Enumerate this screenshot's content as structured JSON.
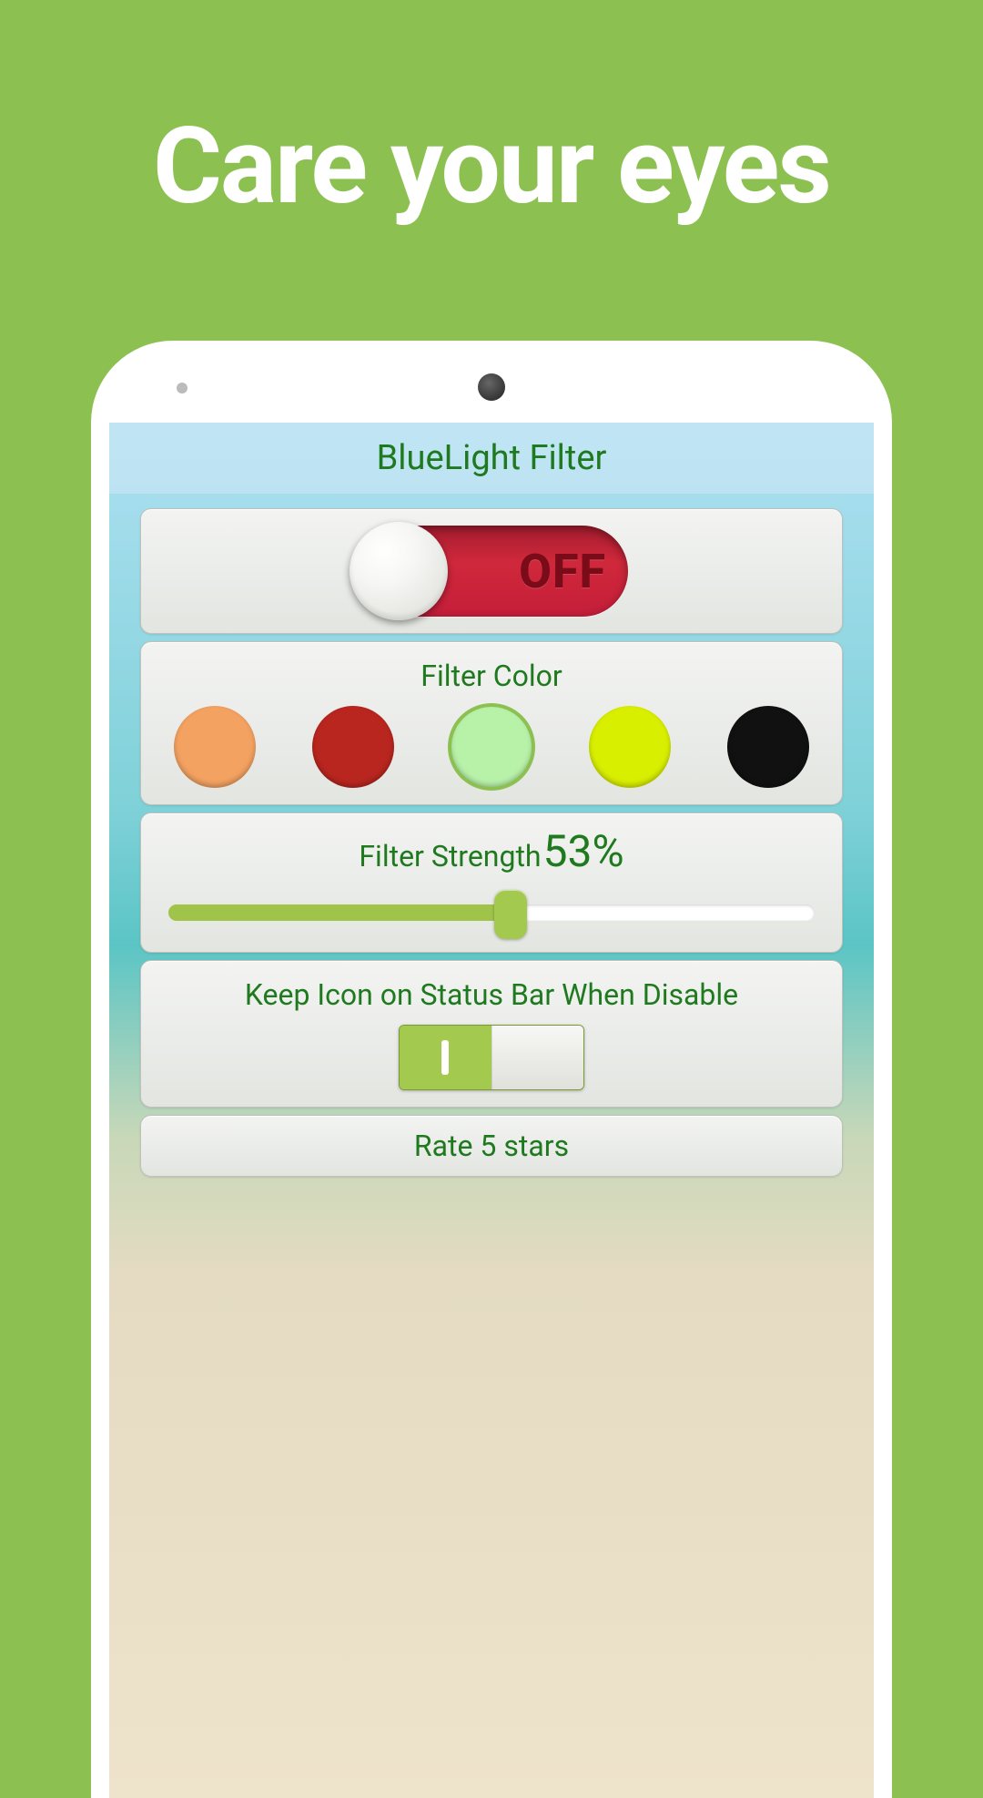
{
  "tagline": "Care your eyes",
  "app": {
    "title": "BlueLight Filter"
  },
  "toggle": {
    "state_label": "OFF"
  },
  "filter_color": {
    "label": "Filter Color",
    "options": [
      {
        "name": "orange",
        "hex": "#f4a261",
        "selected": false
      },
      {
        "name": "red",
        "hex": "#b9261f",
        "selected": false
      },
      {
        "name": "green",
        "hex": "#b8f2a9",
        "selected": true
      },
      {
        "name": "yellow",
        "hex": "#d9ef00",
        "selected": false
      },
      {
        "name": "black",
        "hex": "#111111",
        "selected": false
      }
    ]
  },
  "strength": {
    "label": "Filter Strength",
    "value_text": "53%",
    "value": 53,
    "min": 0,
    "max": 100
  },
  "keep_icon": {
    "label": "Keep Icon on Status Bar When Disable",
    "on": true
  },
  "rate": {
    "label": "Rate 5 stars"
  },
  "colors": {
    "accent": "#8cc152",
    "text_green": "#1f7a1f",
    "toggle_off": "#c41e3a"
  }
}
